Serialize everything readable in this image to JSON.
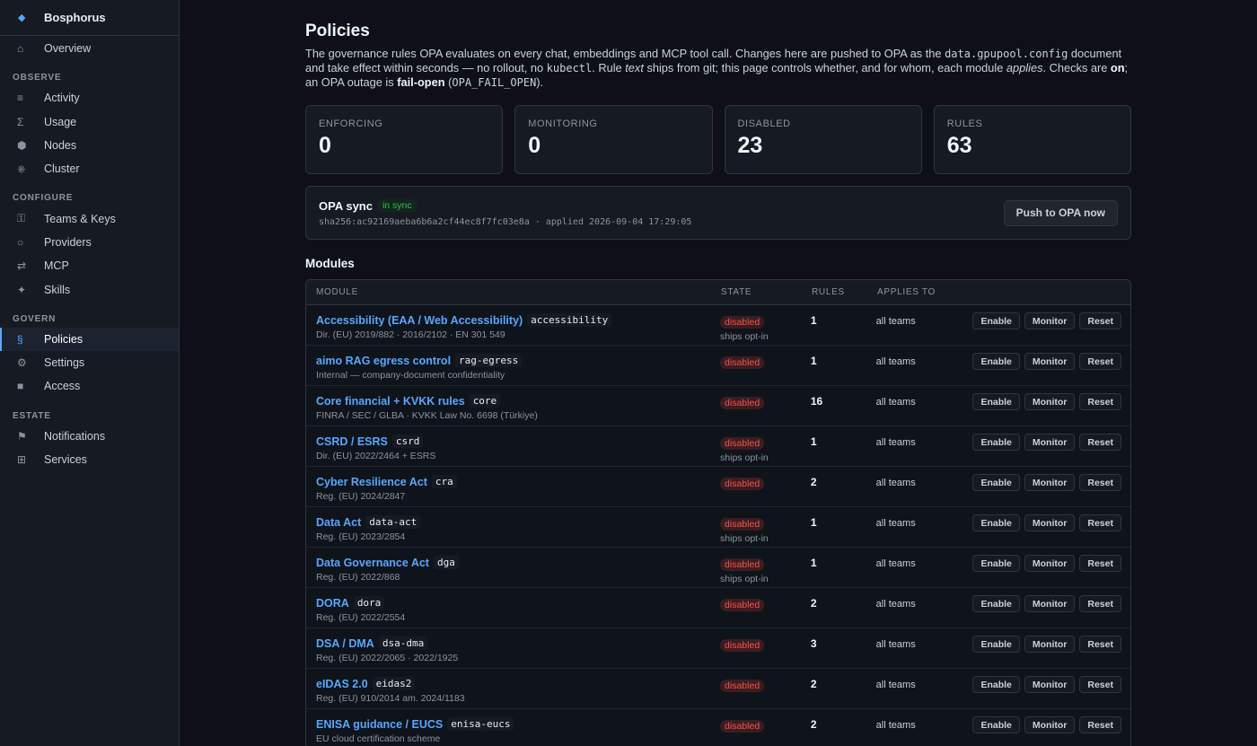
{
  "sidebar": {
    "brand": "Bosphorus",
    "brand_icon": "◆",
    "overview": {
      "label": "Overview",
      "icon": "⌂"
    },
    "sections": [
      {
        "label": "OBSERVE",
        "items": [
          {
            "label": "Activity",
            "icon": "≡",
            "name": "activity"
          },
          {
            "label": "Usage",
            "icon": "Σ",
            "name": "usage"
          },
          {
            "label": "Nodes",
            "icon": "⬢",
            "name": "nodes"
          },
          {
            "label": "Cluster",
            "icon": "⎈",
            "name": "cluster"
          }
        ]
      },
      {
        "label": "CONFIGURE",
        "items": [
          {
            "label": "Teams & Keys",
            "icon": "⚿",
            "name": "teams-keys"
          },
          {
            "label": "Providers",
            "icon": "○",
            "name": "providers"
          },
          {
            "label": "MCP",
            "icon": "⇄",
            "name": "mcp"
          },
          {
            "label": "Skills",
            "icon": "✦",
            "name": "skills"
          }
        ]
      },
      {
        "label": "GOVERN",
        "items": [
          {
            "label": "Policies",
            "icon": "§",
            "name": "policies",
            "active": true
          },
          {
            "label": "Settings",
            "icon": "⚙",
            "name": "settings"
          },
          {
            "label": "Access",
            "icon": "■",
            "name": "access"
          }
        ]
      },
      {
        "label": "ESTATE",
        "items": [
          {
            "label": "Notifications",
            "icon": "⚑",
            "name": "notifications"
          },
          {
            "label": "Services",
            "icon": "⊞",
            "name": "services"
          }
        ]
      }
    ]
  },
  "page": {
    "title": "Policies",
    "desc": {
      "p1": "The governance rules OPA evaluates on every chat, embeddings and MCP tool call. Changes here are pushed to OPA as the ",
      "code1": "data.gpupool.config",
      "p2": " document and take effect within seconds — no rollout, no ",
      "code2": "kubectl",
      "p3": ". Rule ",
      "em1": "text",
      "p4": " ships from git; this page controls whether, and for whom, each module ",
      "em2": "applies",
      "p5": ". Checks are ",
      "b1": "on",
      "p6": "; an OPA outage is ",
      "b2": "fail-open",
      "p7": " (",
      "code3": "OPA_FAIL_OPEN",
      "p8": ")."
    }
  },
  "stats": [
    {
      "label": "ENFORCING",
      "value": "0",
      "name": "enforcing"
    },
    {
      "label": "MONITORING",
      "value": "0",
      "name": "monitoring"
    },
    {
      "label": "DISABLED",
      "value": "23",
      "name": "disabled"
    },
    {
      "label": "RULES",
      "value": "63",
      "name": "rules"
    }
  ],
  "sync": {
    "title": "OPA sync",
    "badge": "in sync",
    "hash": "sha256:ac92169aeba6b6a2cf44ec8f7fc03e8a · applied 2026-09-04 17:29:05",
    "push_label": "Push to OPA now"
  },
  "modules": {
    "title": "Modules",
    "columns": {
      "module": "MODULE",
      "state": "STATE",
      "rules": "RULES",
      "applies": "APPLIES TO"
    },
    "actions": {
      "enable": "Enable",
      "monitor": "Monitor",
      "reset": "Reset"
    },
    "rows": [
      {
        "name": "Accessibility (EAA / Web Accessibility)",
        "key": "accessibility",
        "sub": "Dir. (EU) 2019/882 · 2016/2102 · EN 301 549",
        "state": "disabled",
        "optin": "ships opt-in",
        "rules": "1",
        "applies": "all teams"
      },
      {
        "name": "aimo RAG egress control",
        "key": "rag-egress",
        "sub": "Internal — company-document confidentiality",
        "state": "disabled",
        "optin": "",
        "rules": "1",
        "applies": "all teams"
      },
      {
        "name": "Core financial + KVKK rules",
        "key": "core",
        "sub": "FINRA / SEC / GLBA · KVKK Law No. 6698 (Türkiye)",
        "state": "disabled",
        "optin": "",
        "rules": "16",
        "applies": "all teams"
      },
      {
        "name": "CSRD / ESRS",
        "key": "csrd",
        "sub": "Dir. (EU) 2022/2464 + ESRS",
        "state": "disabled",
        "optin": "ships opt-in",
        "rules": "1",
        "applies": "all teams"
      },
      {
        "name": "Cyber Resilience Act",
        "key": "cra",
        "sub": "Reg. (EU) 2024/2847",
        "state": "disabled",
        "optin": "",
        "rules": "2",
        "applies": "all teams"
      },
      {
        "name": "Data Act",
        "key": "data-act",
        "sub": "Reg. (EU) 2023/2854",
        "state": "disabled",
        "optin": "ships opt-in",
        "rules": "1",
        "applies": "all teams"
      },
      {
        "name": "Data Governance Act",
        "key": "dga",
        "sub": "Reg. (EU) 2022/868",
        "state": "disabled",
        "optin": "ships opt-in",
        "rules": "1",
        "applies": "all teams"
      },
      {
        "name": "DORA",
        "key": "dora",
        "sub": "Reg. (EU) 2022/2554",
        "state": "disabled",
        "optin": "",
        "rules": "2",
        "applies": "all teams"
      },
      {
        "name": "DSA / DMA",
        "key": "dsa-dma",
        "sub": "Reg. (EU) 2022/2065 · 2022/1925",
        "state": "disabled",
        "optin": "",
        "rules": "3",
        "applies": "all teams"
      },
      {
        "name": "eIDAS 2.0",
        "key": "eidas2",
        "sub": "Reg. (EU) 910/2014 am. 2024/1183",
        "state": "disabled",
        "optin": "",
        "rules": "2",
        "applies": "all teams"
      },
      {
        "name": "ENISA guidance / EUCS",
        "key": "enisa-eucs",
        "sub": "EU cloud certification scheme",
        "state": "disabled",
        "optin": "",
        "rules": "2",
        "applies": "all teams"
      }
    ]
  }
}
